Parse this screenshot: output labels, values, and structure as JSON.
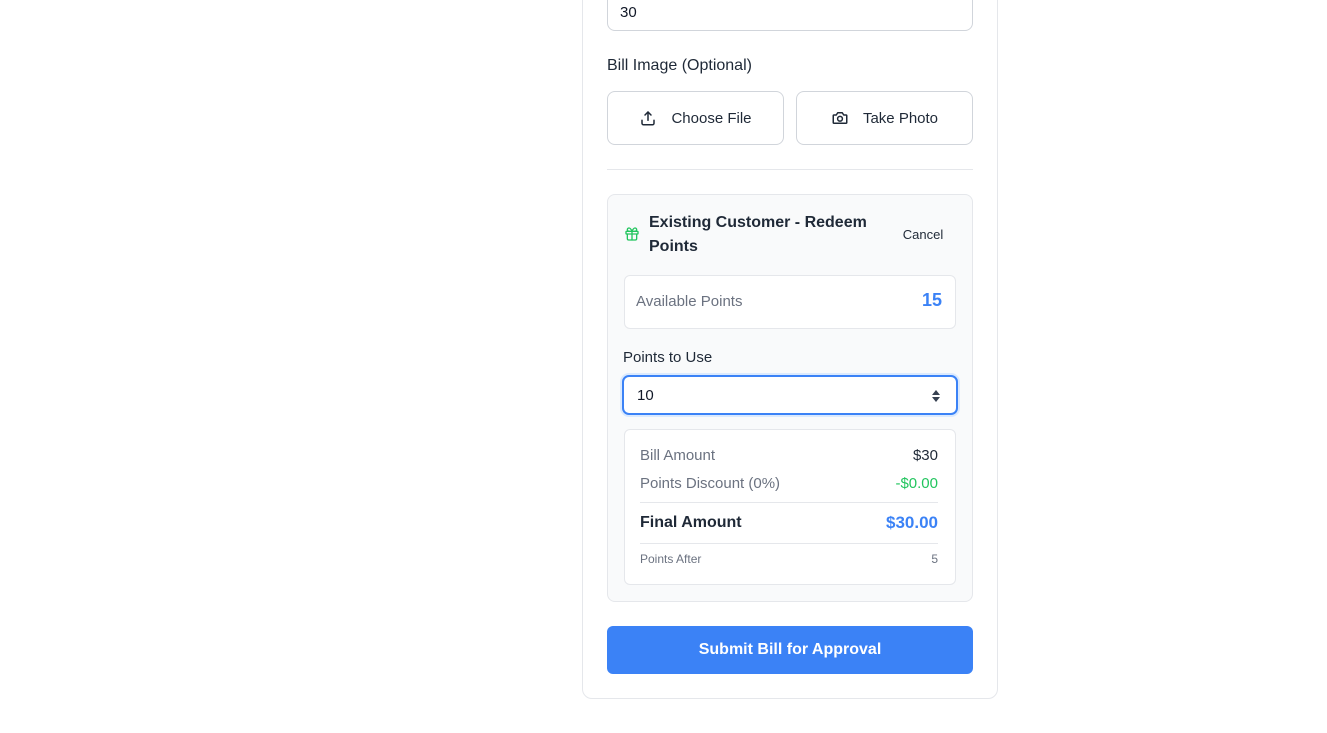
{
  "form": {
    "bill_amount_value": "30",
    "bill_image_label": "Bill Image (Optional)",
    "choose_file_label": "Choose File",
    "take_photo_label": "Take Photo"
  },
  "redeem": {
    "title": "Existing Customer - Redeem Points",
    "cancel_label": "Cancel",
    "available_label": "Available Points",
    "available_value": "15",
    "points_to_use_label": "Points to Use",
    "points_to_use_value": "10",
    "summary": {
      "bill_amount_label": "Bill Amount",
      "bill_amount_value": "$30",
      "discount_label": "Points Discount (0%)",
      "discount_value": "-$0.00",
      "final_label": "Final Amount",
      "final_value": "$30.00",
      "points_after_label": "Points After",
      "points_after_value": "5"
    }
  },
  "submit_label": "Submit Bill for Approval",
  "colors": {
    "accent": "#3b82f6",
    "success": "#22c55e",
    "muted": "#6b7280"
  },
  "icons": {
    "upload": "upload-icon",
    "camera": "camera-icon",
    "gift": "gift-icon",
    "spinner": "spinner-arrows-icon"
  }
}
